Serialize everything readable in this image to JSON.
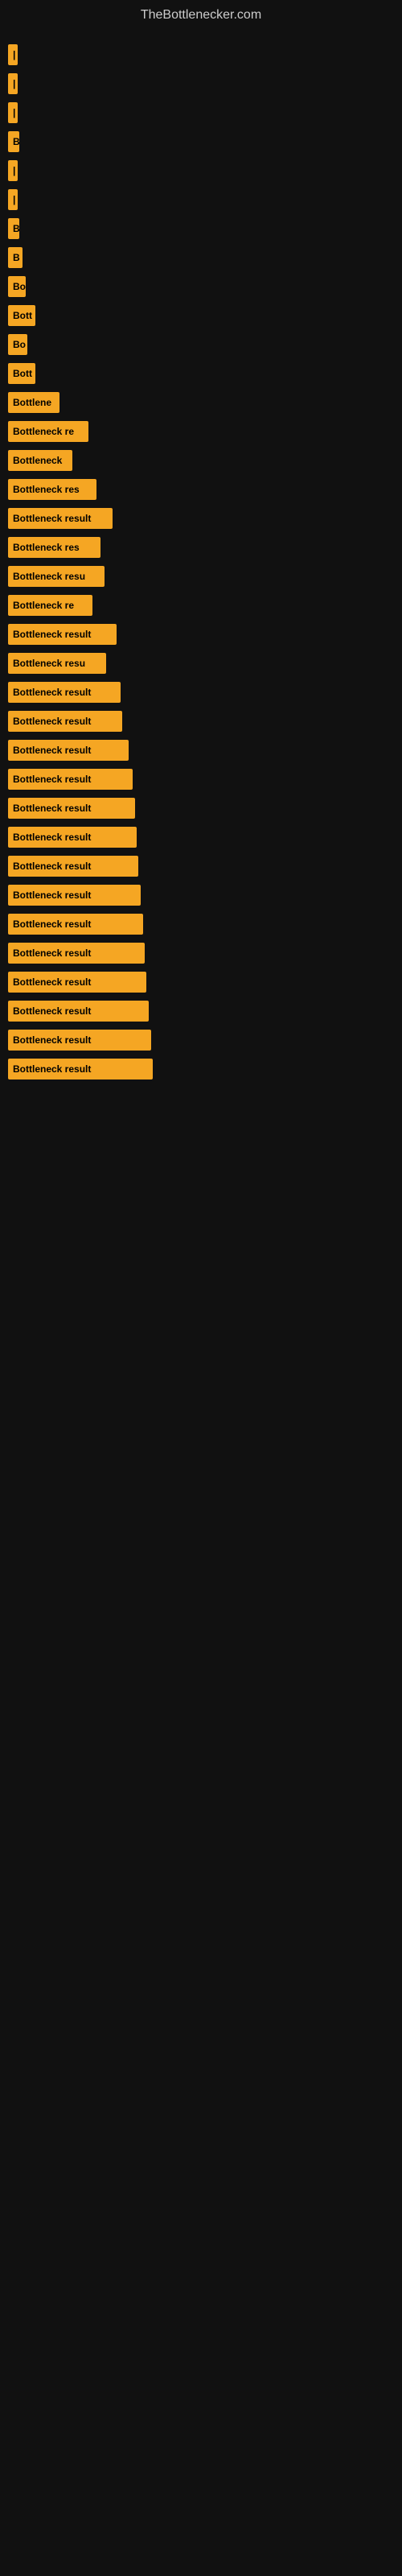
{
  "site": {
    "title": "TheBottlenecker.com"
  },
  "bars": [
    {
      "label": "|",
      "width": 8
    },
    {
      "label": "|",
      "width": 9
    },
    {
      "label": "|",
      "width": 10
    },
    {
      "label": "B",
      "width": 14
    },
    {
      "label": "|",
      "width": 10
    },
    {
      "label": "|",
      "width": 10
    },
    {
      "label": "B",
      "width": 14
    },
    {
      "label": "B",
      "width": 18
    },
    {
      "label": "Bo",
      "width": 22
    },
    {
      "label": "Bott",
      "width": 34
    },
    {
      "label": "Bo",
      "width": 24
    },
    {
      "label": "Bott",
      "width": 34
    },
    {
      "label": "Bottlene",
      "width": 64
    },
    {
      "label": "Bottleneck re",
      "width": 100
    },
    {
      "label": "Bottleneck",
      "width": 80
    },
    {
      "label": "Bottleneck res",
      "width": 110
    },
    {
      "label": "Bottleneck result",
      "width": 130
    },
    {
      "label": "Bottleneck res",
      "width": 115
    },
    {
      "label": "Bottleneck resu",
      "width": 120
    },
    {
      "label": "Bottleneck re",
      "width": 105
    },
    {
      "label": "Bottleneck result",
      "width": 135
    },
    {
      "label": "Bottleneck resu",
      "width": 122
    },
    {
      "label": "Bottleneck result",
      "width": 140
    },
    {
      "label": "Bottleneck result",
      "width": 142
    },
    {
      "label": "Bottleneck result",
      "width": 150
    },
    {
      "label": "Bottleneck result",
      "width": 155
    },
    {
      "label": "Bottleneck result",
      "width": 158
    },
    {
      "label": "Bottleneck result",
      "width": 160
    },
    {
      "label": "Bottleneck result",
      "width": 162
    },
    {
      "label": "Bottleneck result",
      "width": 165
    },
    {
      "label": "Bottleneck result",
      "width": 168
    },
    {
      "label": "Bottleneck result",
      "width": 170
    },
    {
      "label": "Bottleneck result",
      "width": 172
    },
    {
      "label": "Bottleneck result",
      "width": 175
    },
    {
      "label": "Bottleneck result",
      "width": 178
    },
    {
      "label": "Bottleneck result",
      "width": 180
    }
  ]
}
